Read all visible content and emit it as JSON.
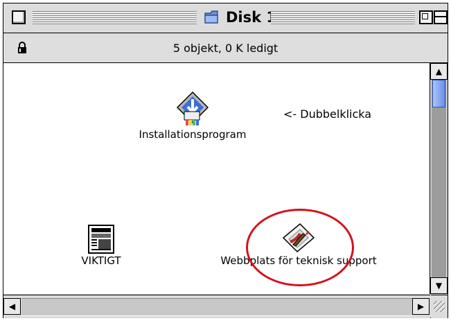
{
  "window": {
    "title": "Disk 1",
    "info": "5 objekt, 0 K ledigt"
  },
  "items": [
    {
      "label": "Installationsprogram",
      "icon": "installer-icon"
    },
    {
      "label": "VIKTIGT",
      "icon": "newspaper-document-icon"
    },
    {
      "label": "Webbplats för teknisk support",
      "icon": "web-shortcut-icon"
    }
  ],
  "hint": "<- Dubbelklicka",
  "annotation": {
    "color": "#d5101c"
  },
  "colors": {
    "scroll_thumb": "#6a8fe6"
  }
}
